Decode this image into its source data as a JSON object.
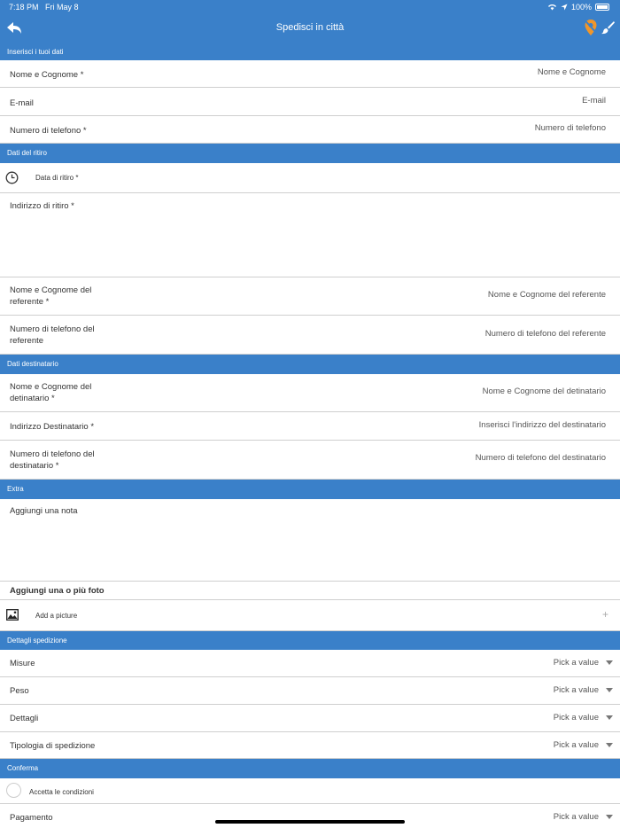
{
  "status_bar": {
    "time": "7:18 PM",
    "date": "Fri May 8",
    "battery": "100%"
  },
  "nav": {
    "title": "Spedisci in città",
    "back_icon": "back-arrow-icon",
    "pin_icon": "location-off-icon",
    "brush_icon": "brush-icon"
  },
  "sections": {
    "user": "Inserisci i tuoi dati",
    "pickup": "Dati del ritiro",
    "recipient": "Dati destinatario",
    "extra": "Extra",
    "shipment": "Dettagli spedizione",
    "confirm": "Conferma"
  },
  "user": {
    "name_label": "Nome e Cognome *",
    "name_placeholder": "Nome e Cognome",
    "email_label": "E-mail",
    "email_placeholder": "E-mail",
    "phone_label": "Numero di telefono *",
    "phone_placeholder": "Numero di telefono"
  },
  "pickup": {
    "date_label": "Data di ritiro *",
    "address_label": "Indirizzo di ritiro *",
    "ref_name_label": "Nome e Cognome del referente *",
    "ref_name_placeholder": "Nome e Cognome del referente",
    "ref_phone_label": "Numero di telefono del referente",
    "ref_phone_placeholder": "Numero di telefono del referente"
  },
  "recipient": {
    "name_label": "Nome e Cognome del detinatario *",
    "name_placeholder": "Nome e Cognome del detinatario",
    "address_label": "Indirizzo Destinatario *",
    "address_placeholder": "Inserisci l'indirizzo del destinatario",
    "phone_label": "Numero di telefono del destinatario *",
    "phone_placeholder": "Numero di telefono del destinatario"
  },
  "extra": {
    "note_label": "Aggiungi una nota",
    "photos_header": "Aggiungi una o più foto",
    "add_picture": "Add a picture",
    "plus": "+"
  },
  "shipment": {
    "pick_value": "Pick a value",
    "fields": [
      "Misure",
      "Peso",
      "Dettagli",
      "Tipologia di spedizione"
    ]
  },
  "confirm": {
    "accept_label": "Accetta le condizioni",
    "payment_label": "Pagamento"
  },
  "colors": {
    "accent": "#3a80c9"
  }
}
